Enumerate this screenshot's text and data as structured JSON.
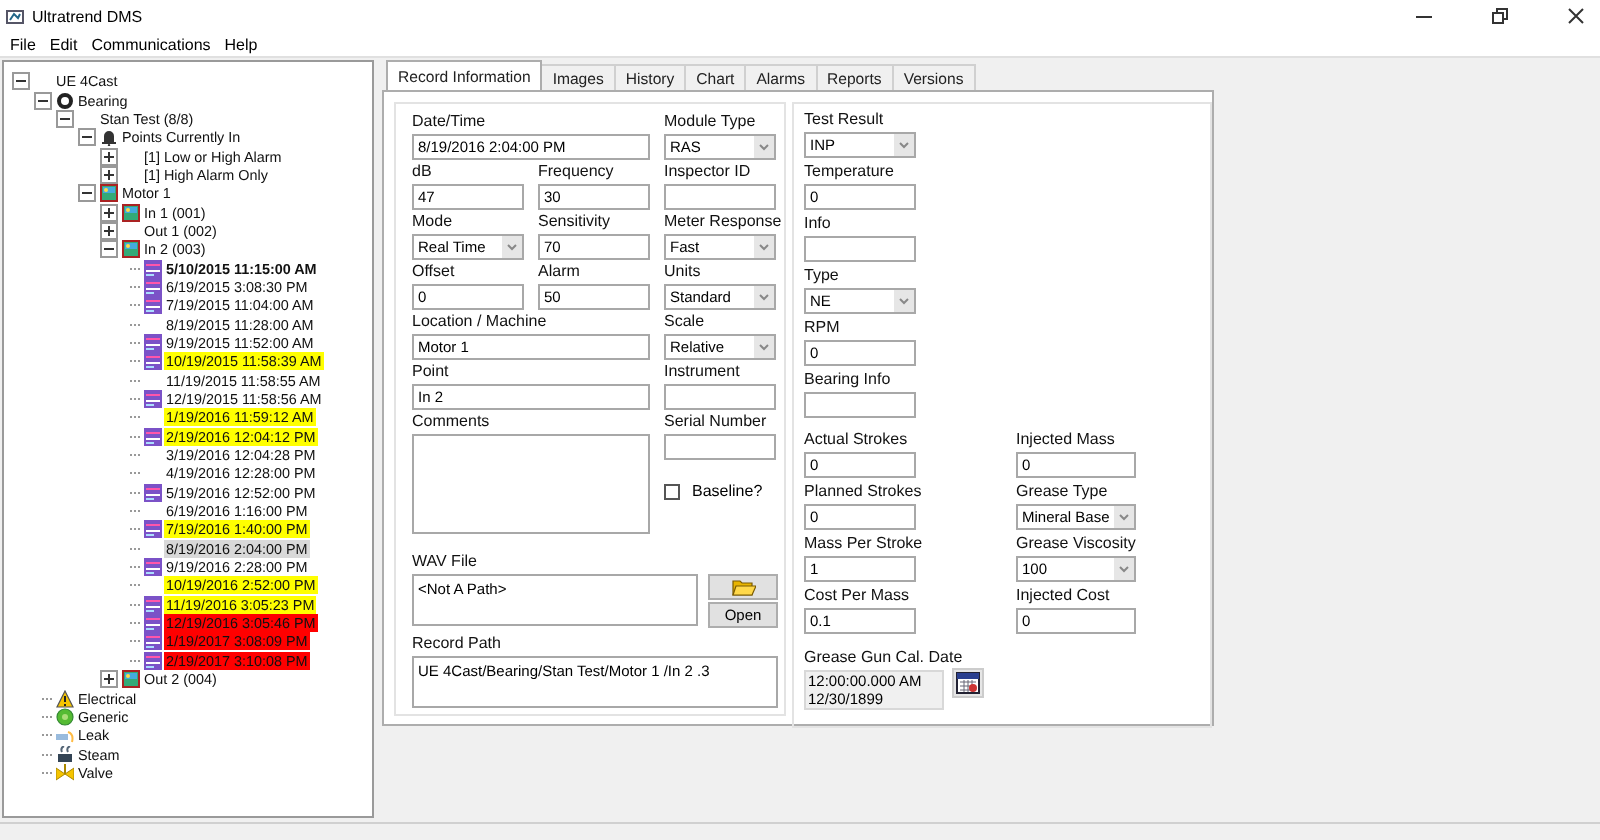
{
  "window": {
    "title": "Ultratrend DMS"
  },
  "menu": [
    "File",
    "Edit",
    "Communications",
    "Help"
  ],
  "tree": [
    {
      "label": "UE 4Cast",
      "expanded": true,
      "children": [
        {
          "label": "Bearing",
          "kind": "bearing",
          "expanded": true,
          "children": [
            {
              "label": "Stan Test (8/8)",
              "expanded": true,
              "children": [
                {
                  "label": "Points Currently In",
                  "kind": "alarm-group",
                  "expanded": true,
                  "children": [
                    {
                      "label": "[1] Low or High Alarm",
                      "expanded": false
                    },
                    {
                      "label": "[1] High Alarm Only",
                      "expanded": false
                    }
                  ]
                },
                {
                  "label": "Motor 1",
                  "kind": "machine",
                  "expanded": true,
                  "children": [
                    {
                      "label": "In 1 (001)",
                      "kind": "point",
                      "expanded": false
                    },
                    {
                      "label": "Out 1 (002)",
                      "expanded": false
                    },
                    {
                      "label": "In 2 (003)",
                      "kind": "point",
                      "expanded": true,
                      "children": [
                        {
                          "label": "5/10/2015 11:15:00 AM",
                          "kind": "record",
                          "selected": false,
                          "bold": true
                        },
                        {
                          "label": "6/19/2015 3:08:30 PM",
                          "kind": "record",
                          "selected": false,
                          "bold": false
                        },
                        {
                          "label": "7/19/2015 11:04:00 AM",
                          "kind": "record",
                          "selected": false,
                          "bold": false
                        },
                        {
                          "label": "8/19/2015 11:28:00 AM",
                          "selected": false,
                          "bold": false
                        },
                        {
                          "label": "9/19/2015 11:52:00 AM",
                          "kind": "record",
                          "selected": false,
                          "bold": false
                        },
                        {
                          "label": "10/19/2015 11:58:39 AM",
                          "kind": "record",
                          "selected": false,
                          "bold": false,
                          "color": "#ffff00"
                        },
                        {
                          "label": "11/19/2015 11:58:55 AM",
                          "selected": false,
                          "bold": false
                        },
                        {
                          "label": "12/19/2015 11:58:56 AM",
                          "kind": "record",
                          "selected": false,
                          "bold": false
                        },
                        {
                          "label": "1/19/2016 11:59:12 AM",
                          "selected": false,
                          "bold": false,
                          "color": "#ffff00"
                        },
                        {
                          "label": "2/19/2016 12:04:12 PM",
                          "kind": "record",
                          "selected": false,
                          "bold": false,
                          "color": "#ffff00"
                        },
                        {
                          "label": "3/19/2016 12:04:28 PM",
                          "selected": false,
                          "bold": false
                        },
                        {
                          "label": "4/19/2016 12:28:00 PM",
                          "selected": false,
                          "bold": false
                        },
                        {
                          "label": "5/19/2016 12:52:00 PM",
                          "kind": "record",
                          "selected": false,
                          "bold": false
                        },
                        {
                          "label": "6/19/2016 1:16:00 PM",
                          "selected": false,
                          "bold": false
                        },
                        {
                          "label": "7/19/2016 1:40:00 PM",
                          "kind": "record",
                          "selected": false,
                          "bold": false,
                          "color": "#ffff00"
                        },
                        {
                          "label": "8/19/2016 2:04:00 PM",
                          "selected": true,
                          "bold": false
                        },
                        {
                          "label": "9/19/2016 2:28:00 PM",
                          "kind": "record",
                          "selected": false,
                          "bold": false
                        },
                        {
                          "label": "10/19/2016 2:52:00 PM",
                          "selected": false,
                          "bold": false,
                          "color": "#ffff00"
                        },
                        {
                          "label": "11/19/2016 3:05:23 PM",
                          "kind": "record",
                          "selected": false,
                          "bold": false,
                          "color": "#ffff00"
                        },
                        {
                          "label": "12/19/2016 3:05:46 PM",
                          "kind": "record",
                          "selected": false,
                          "bold": false,
                          "color": "#ff0000"
                        },
                        {
                          "label": "1/19/2017 3:08:09 PM",
                          "kind": "record",
                          "selected": false,
                          "bold": false,
                          "color": "#ff0000"
                        },
                        {
                          "label": "2/19/2017 3:10:08 PM",
                          "kind": "record",
                          "selected": false,
                          "bold": false,
                          "color": "#ff0000"
                        }
                      ]
                    },
                    {
                      "label": "Out 2 (004)",
                      "kind": "point",
                      "expanded": false
                    }
                  ]
                }
              ]
            }
          ]
        },
        {
          "label": "Electrical",
          "kind": "electrical"
        },
        {
          "label": "Generic",
          "kind": "generic"
        },
        {
          "label": "Leak",
          "kind": "leak"
        },
        {
          "label": "Steam",
          "kind": "steam"
        },
        {
          "label": "Valve",
          "kind": "valve"
        }
      ]
    }
  ],
  "tabs": [
    {
      "label": "Record Information",
      "selected": true
    },
    {
      "label": "Images",
      "selected": false
    },
    {
      "label": "History",
      "selected": false
    },
    {
      "label": "Chart",
      "selected": false
    },
    {
      "label": "Alarms",
      "selected": false
    },
    {
      "label": "Reports",
      "selected": false
    },
    {
      "label": "Versions",
      "selected": false
    }
  ],
  "record_form": {
    "rows": [
      [
        {
          "label": "Date/Time",
          "kind": "text",
          "value": "8/19/2016 2:04:00 PM"
        },
        {
          "label": "Module Type",
          "kind": "select",
          "value": "RAS"
        }
      ],
      [
        {
          "label": "dB",
          "kind": "text",
          "value": "47"
        },
        {
          "label": "Frequency",
          "kind": "text",
          "value": "30"
        },
        {
          "label": "Inspector ID",
          "kind": "text"
        }
      ],
      [
        {
          "label": "Mode",
          "kind": "select",
          "value": "Real Time"
        },
        {
          "label": "Sensitivity",
          "kind": "text",
          "value": "70"
        },
        {
          "label": "Meter Response",
          "kind": "select",
          "value": "Fast"
        }
      ],
      [
        {
          "label": "Offset",
          "kind": "text",
          "value": "0"
        },
        {
          "label": "Alarm",
          "kind": "text",
          "value": "50"
        },
        {
          "label": "Units",
          "kind": "select",
          "value": "Standard"
        }
      ],
      [
        {
          "label": "Location / Machine",
          "kind": "text",
          "value": "Motor 1"
        },
        {
          "label": "Scale",
          "kind": "select",
          "value": "Relative"
        }
      ],
      [
        {
          "label": "Point",
          "kind": "text",
          "value": "In 2"
        },
        {
          "label": "Instrument",
          "kind": "text"
        }
      ],
      [
        {
          "label": "Comments",
          "kind": "textarea"
        },
        {
          "label": "Serial Number",
          "kind": "text"
        },
        {
          "label": "Baseline?",
          "kind": "checkbox",
          "checked": false
        }
      ]
    ],
    "wav_file": {
      "label": "WAV File",
      "value": "<Not A Path>",
      "button": "Open"
    },
    "record_path": {
      "label": "Record Path",
      "value": "UE 4Cast/Bearing/Stan Test/Motor 1 /In 2 .3"
    }
  },
  "test_form": {
    "fields": [
      {
        "label": "Test Result",
        "kind": "select",
        "value": "INP"
      },
      {
        "label": "Temperature",
        "kind": "text",
        "value": "0"
      },
      {
        "label": "Info",
        "kind": "text"
      },
      {
        "label": "Type",
        "kind": "select",
        "value": "NE"
      },
      {
        "label": "RPM",
        "kind": "text",
        "value": "0"
      },
      {
        "label": "Bearing Info",
        "kind": "text"
      }
    ],
    "pairs": [
      [
        {
          "label": "Actual Strokes",
          "kind": "text",
          "value": "0"
        },
        {
          "label": "Injected Mass",
          "kind": "text",
          "value": "0"
        }
      ],
      [
        {
          "label": "Planned Strokes",
          "kind": "text",
          "value": "0"
        },
        {
          "label": "Grease Type",
          "kind": "select",
          "value": "Mineral Base"
        }
      ],
      [
        {
          "label": "Mass Per Stroke",
          "kind": "text",
          "value": "1"
        },
        {
          "label": "Grease Viscosity",
          "kind": "select",
          "value": "100"
        }
      ],
      [
        {
          "label": "Cost Per Mass",
          "kind": "text",
          "value": "0.1"
        },
        {
          "label": "Injected Cost",
          "kind": "text",
          "value": "0"
        }
      ]
    ],
    "cal_date": {
      "label": "Grease Gun Cal. Date",
      "lines": [
        "12:00:00.000 AM",
        "12/30/1899"
      ]
    }
  }
}
